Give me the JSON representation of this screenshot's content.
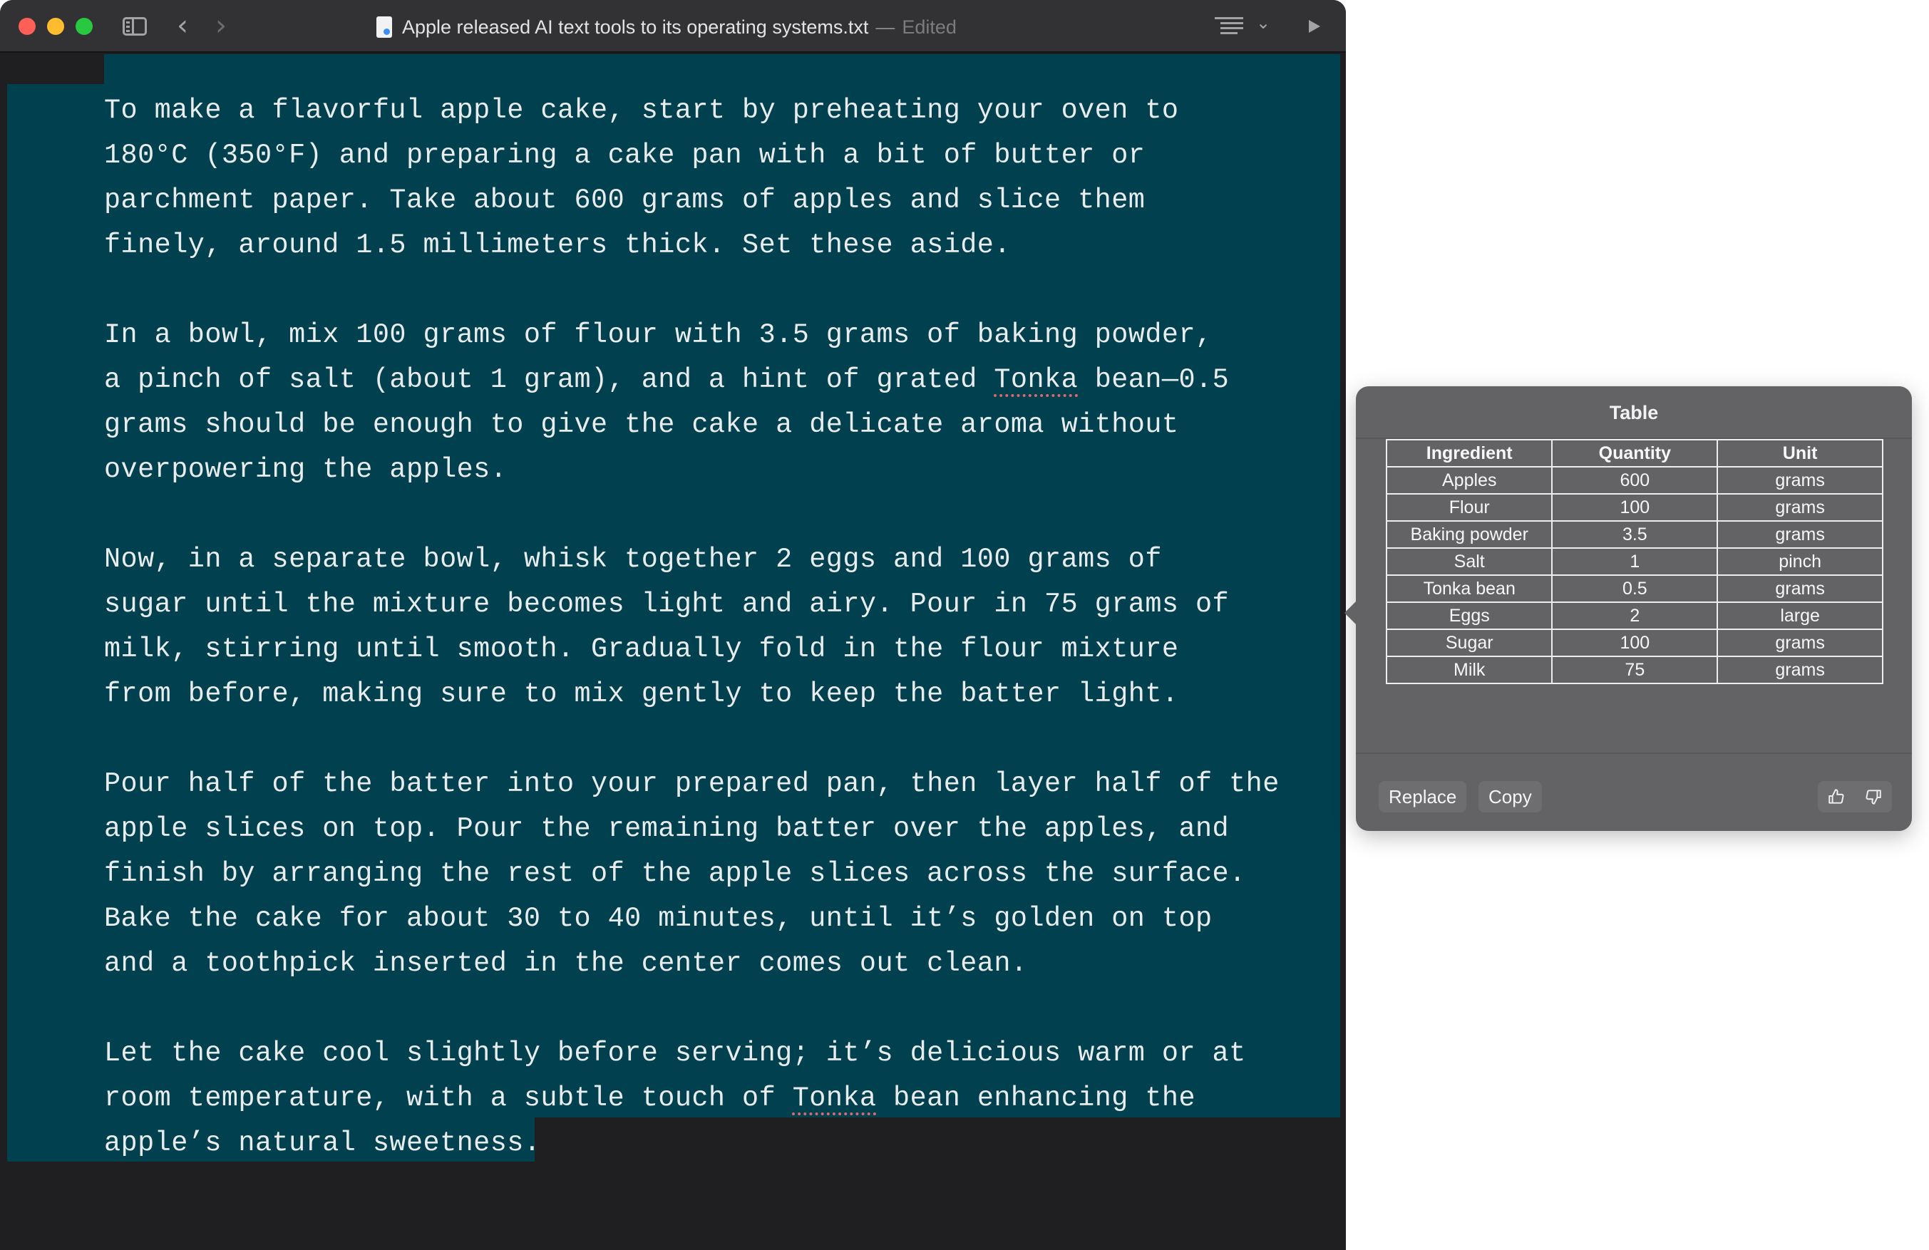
{
  "window": {
    "title": "Apple released AI text tools to its operating systems.txt",
    "title_separator": "—",
    "status": "Edited"
  },
  "editor": {
    "lines": [
      "To make a flavorful apple cake, start by preheating your oven to",
      "180°C (350°F) and preparing a cake pan with a bit of butter or",
      "parchment paper. Take about 600 grams of apples and slice them",
      "finely, around 1.5 millimeters thick. Set these aside.",
      "",
      "In a bowl, mix 100 grams of flour with 3.5 grams of baking powder,",
      "a pinch of salt (about 1 gram), and a hint of grated ",
      "grams should be enough to give the cake a delicate aroma without",
      "overpowering the apples.",
      "",
      "Now, in a separate bowl, whisk together 2 eggs and 100 grams of",
      "sugar until the mixture becomes light and airy. Pour in 75 grams of",
      "milk, stirring until smooth. Gradually fold in the flour mixture",
      "from before, making sure to mix gently to keep the batter light.",
      "",
      "Pour half of the batter into your prepared pan, then layer half of the",
      "apple slices on top. Pour the remaining batter over the apples, and",
      "finish by arranging the rest of the apple slices across the surface.",
      "Bake the cake for about 30 to 40 minutes, until it’s golden on top",
      "and a toothpick inserted in the center comes out clean.",
      "",
      "Let the cake cool slightly before serving; it’s delicious warm or at",
      "room temperature, with a subtle touch of ",
      "apple’s natural sweetness."
    ],
    "misspelled_word": "Tonka",
    "line7_tail": " bean—0.5",
    "line23_tail": " bean enhancing the"
  },
  "popover": {
    "title": "Table",
    "table": {
      "headers": [
        "Ingredient",
        "Quantity",
        "Unit"
      ],
      "rows": [
        [
          "Apples",
          "600",
          "grams"
        ],
        [
          "Flour",
          "100",
          "grams"
        ],
        [
          "Baking powder",
          "3.5",
          "grams"
        ],
        [
          "Salt",
          "1",
          "pinch"
        ],
        [
          "Tonka bean",
          "0.5",
          "grams"
        ],
        [
          "Eggs",
          "2",
          "large"
        ],
        [
          "Sugar",
          "100",
          "grams"
        ],
        [
          "Milk",
          "75",
          "grams"
        ]
      ]
    },
    "replace_label": "Replace",
    "copy_label": "Copy"
  },
  "icons": {
    "sidebar": "sidebar-toggle-icon",
    "back": "chevron-left-icon",
    "forward": "chevron-right-icon",
    "document": "text-document-icon",
    "list": "list-format-icon",
    "list_menu": "chevron-down-icon",
    "play": "play-icon",
    "thumbs_up": "thumbs-up-icon",
    "thumbs_down": "thumbs-down-icon"
  },
  "colors": {
    "selection": "#01404f",
    "editor_background": "#1f1f21",
    "popover_background": "#636365",
    "spelling_underline": "#e0676a"
  }
}
